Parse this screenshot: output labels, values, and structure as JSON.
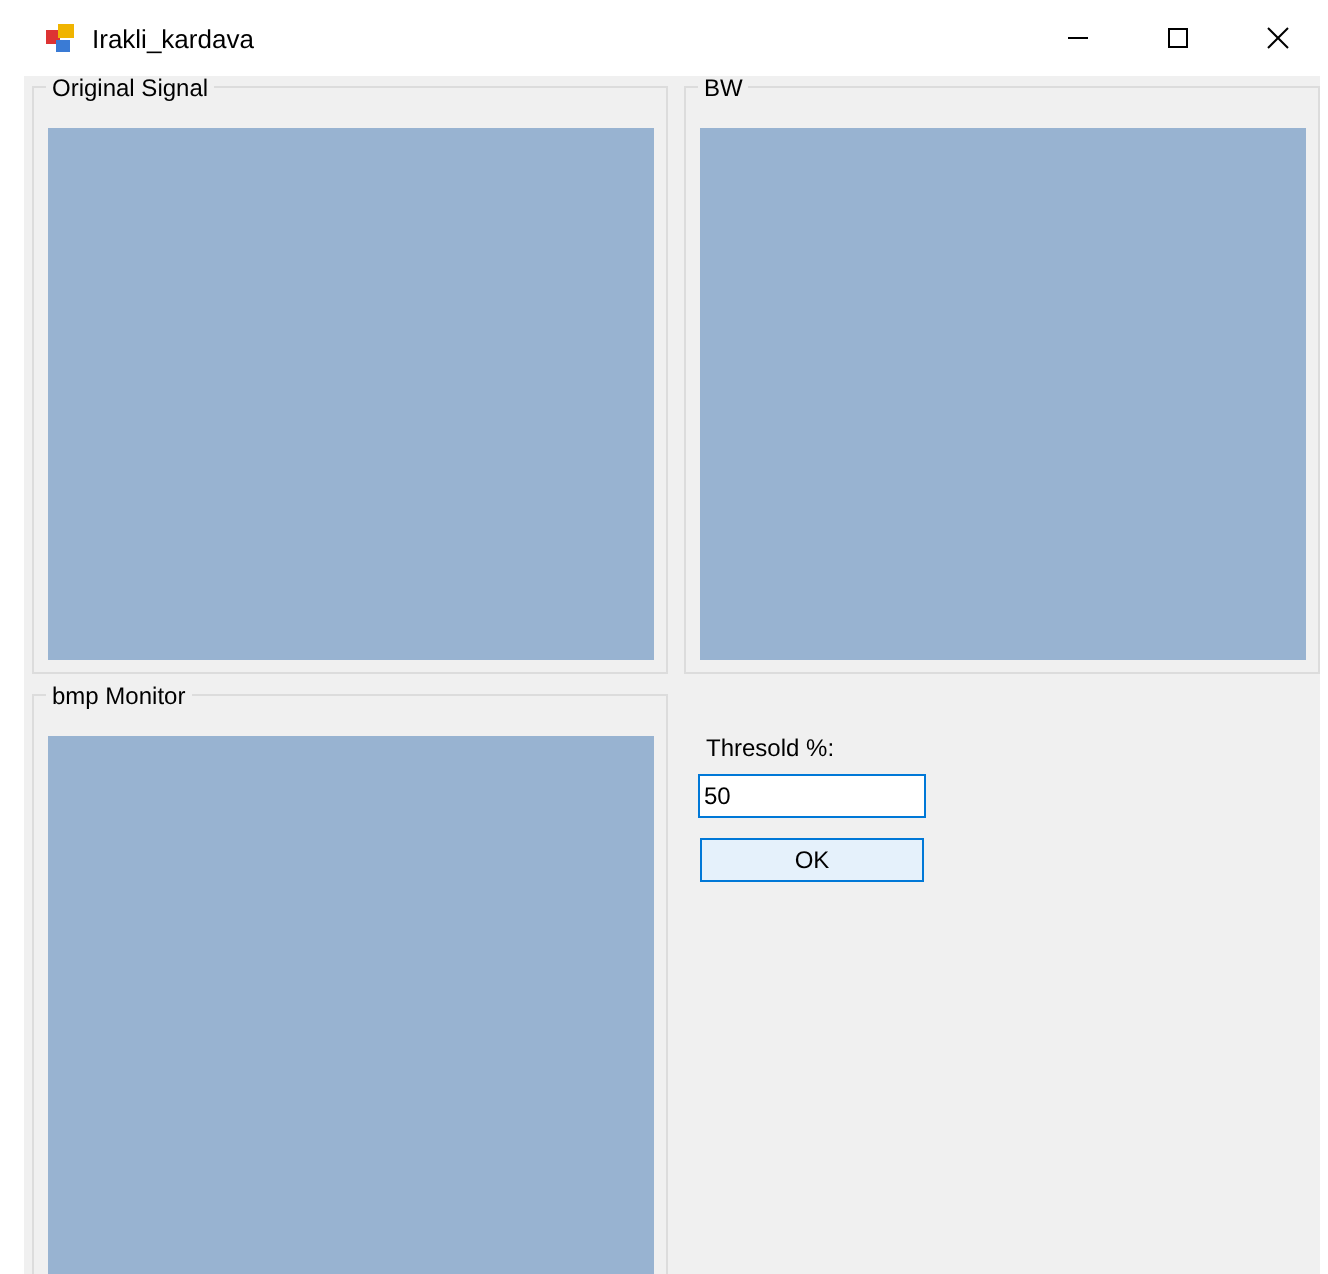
{
  "window": {
    "title": "Irakli_kardava"
  },
  "groups": [
    {
      "title": "Original Signal"
    },
    {
      "title": "BW"
    },
    {
      "title": "bmp Monitor"
    }
  ],
  "threshold": {
    "label": "Thresold %:",
    "value": "50",
    "focused": true
  },
  "buttons": [
    "OK"
  ]
}
